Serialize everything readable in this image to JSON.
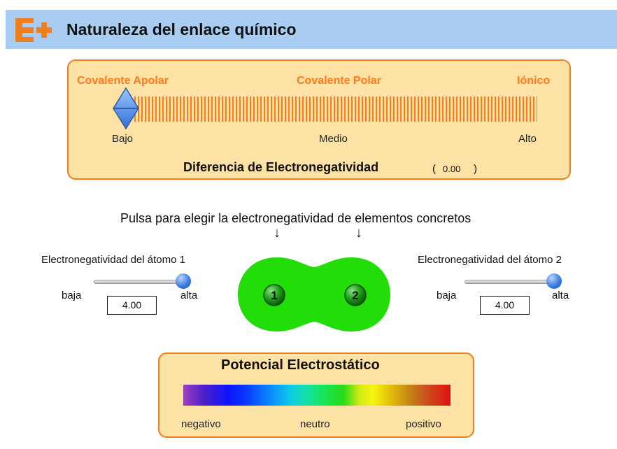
{
  "header": {
    "title": "Naturaleza del enlace químico",
    "logo_icon": "e-plus-logo-icon",
    "band_color": "#a9cdf0",
    "logo_color": "#f07f20"
  },
  "bond_scale": {
    "labels": {
      "apolar": "Covalente Apolar",
      "polar": "Covalente Polar",
      "ionic": "Iónico"
    },
    "scale": {
      "low": "Bajo",
      "mid": "Medio",
      "high": "Alto"
    },
    "title": "Diferencia de Electronegatividad",
    "paren_open": "(",
    "paren_close": ")",
    "value": "0.00",
    "level": 0.0
  },
  "instruction": {
    "text": "Pulsa para elegir la electronegatividad de elementos concretos",
    "arrow": "↓"
  },
  "atom1": {
    "label": "Electronegatividad  del átomo 1",
    "low": "baja",
    "high": "alta",
    "value": "4.00",
    "level": 1.0
  },
  "atom2": {
    "label": "Electronegatividad  del átomo 2",
    "low": "baja",
    "high": "alta",
    "value": "4.00",
    "level": 1.0
  },
  "molecule": {
    "atom1_number": "1",
    "atom2_number": "2",
    "cloud_color": "#22dd08"
  },
  "potential": {
    "title": "Potencial Electrostático",
    "negative": "negativo",
    "neutral": "neutro",
    "positive": "positivo"
  },
  "colors": {
    "panel_bg": "#fde2a6",
    "panel_border": "#f07f20",
    "accent_text": "#ff7a1a"
  }
}
